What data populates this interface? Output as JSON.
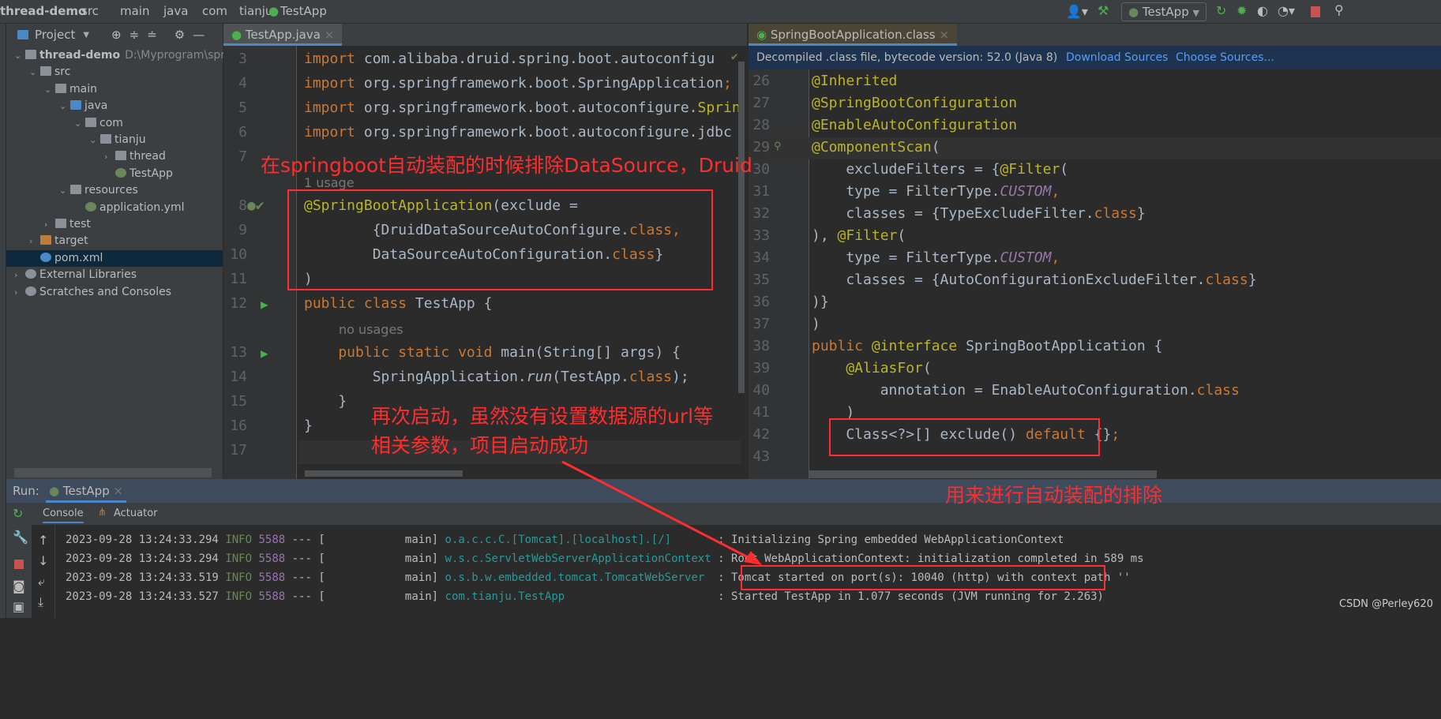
{
  "breadcrumb": [
    "thread-demo",
    "src",
    "main",
    "java",
    "com",
    "tianju",
    "TestApp"
  ],
  "toolbar": {
    "run_config": "TestApp",
    "colors": {
      "green": "#4caf50",
      "stop": "#c75450"
    }
  },
  "project": {
    "title": "Project",
    "tree": [
      {
        "label": "thread-demo",
        "extra": "D:\\Myprogram\\spring",
        "indent": 0,
        "arrow": "v",
        "icon": "folder",
        "bold": true
      },
      {
        "label": "src",
        "indent": 1,
        "arrow": "v",
        "icon": "folder"
      },
      {
        "label": "main",
        "indent": 2,
        "arrow": "v",
        "icon": "folder"
      },
      {
        "label": "java",
        "indent": 3,
        "arrow": "v",
        "icon": "folder-blue"
      },
      {
        "label": "com",
        "indent": 4,
        "arrow": "v",
        "icon": "package"
      },
      {
        "label": "tianju",
        "indent": 5,
        "arrow": "v",
        "icon": "package"
      },
      {
        "label": "thread",
        "indent": 6,
        "arrow": ">",
        "icon": "package"
      },
      {
        "label": "TestApp",
        "indent": 6,
        "arrow": "",
        "icon": "spring-class"
      },
      {
        "label": "resources",
        "indent": 3,
        "arrow": "v",
        "icon": "folder"
      },
      {
        "label": "application.yml",
        "indent": 4,
        "arrow": "",
        "icon": "spring-yml"
      },
      {
        "label": "test",
        "indent": 2,
        "arrow": ">",
        "icon": "folder"
      },
      {
        "label": "target",
        "indent": 1,
        "arrow": ">",
        "icon": "folder-orange"
      },
      {
        "label": "pom.xml",
        "indent": 1,
        "arrow": "",
        "icon": "maven",
        "selected": true
      },
      {
        "label": "External Libraries",
        "indent": 0,
        "arrow": ">",
        "icon": "libraries"
      },
      {
        "label": "Scratches and Consoles",
        "indent": 0,
        "arrow": ">",
        "icon": "scratches"
      }
    ]
  },
  "editor_left": {
    "tab": "TestApp.java",
    "lines": [
      {
        "n": "3",
        "tokens": [
          [
            "kw",
            "import "
          ],
          [
            "",
            "com.alibaba.druid.spring.boot.autoconfigu"
          ]
        ]
      },
      {
        "n": "4",
        "tokens": [
          [
            "kw",
            "import "
          ],
          [
            "",
            "org.springframework.boot.SpringApplication"
          ],
          [
            "kw",
            ";"
          ]
        ]
      },
      {
        "n": "5",
        "tokens": [
          [
            "kw",
            "import "
          ],
          [
            "",
            "org.springframework.boot.autoconfigure."
          ],
          [
            "an",
            "Sprin"
          ]
        ]
      },
      {
        "n": "6",
        "tokens": [
          [
            "kw",
            "import "
          ],
          [
            "",
            "org.springframework.boot.autoconfigure.jdbc"
          ]
        ]
      },
      {
        "n": "7",
        "tokens": []
      },
      {
        "hint": "1 usage"
      },
      {
        "n": "8",
        "tokens": [
          [
            "an",
            "@SpringBootApplication"
          ],
          [
            "",
            "(exclude ="
          ]
        ]
      },
      {
        "n": "9",
        "tokens": [
          [
            "",
            "        {DruidDataSourceAutoConfigure."
          ],
          [
            "kw",
            "class"
          ],
          [
            "kw",
            ","
          ]
        ]
      },
      {
        "n": "10",
        "tokens": [
          [
            "",
            "        DataSourceAutoConfiguration."
          ],
          [
            "kw",
            "class"
          ],
          [
            "",
            "}"
          ]
        ]
      },
      {
        "n": "11",
        "tokens": [
          [
            "",
            ")"
          ]
        ]
      },
      {
        "n": "12",
        "tokens": [
          [
            "kw",
            "public class "
          ],
          [
            "",
            "TestApp {"
          ]
        ]
      },
      {
        "hint": "no usages"
      },
      {
        "n": "13",
        "tokens": [
          [
            "kw",
            "    public static void "
          ],
          [
            "",
            "main(String[] args) {"
          ]
        ]
      },
      {
        "n": "14",
        "tokens": [
          [
            "",
            "        SpringApplication."
          ],
          [
            "it",
            "run"
          ],
          [
            "",
            "(TestApp."
          ],
          [
            "kw",
            "class"
          ],
          [
            "",
            "); "
          ]
        ]
      },
      {
        "n": "15",
        "tokens": [
          [
            "",
            "    }"
          ]
        ]
      },
      {
        "n": "16",
        "tokens": [
          [
            "",
            "}"
          ]
        ]
      },
      {
        "n": "17",
        "tokens": []
      }
    ]
  },
  "editor_right": {
    "tab": "SpringBootApplication.class",
    "banner": "Decompiled .class file, bytecode version: 52.0 (Java 8)",
    "download_sources": "Download Sources",
    "choose_sources": "Choose Sources...",
    "lines": [
      {
        "n": "26",
        "tokens": [
          [
            "an",
            "@Inherited"
          ]
        ]
      },
      {
        "n": "27",
        "tokens": [
          [
            "an",
            "@SpringBootConfiguration"
          ]
        ]
      },
      {
        "n": "28",
        "tokens": [
          [
            "an",
            "@EnableAutoConfiguration"
          ]
        ]
      },
      {
        "n": "29",
        "tokens": [
          [
            "an",
            "@ComponentScan"
          ],
          [
            "",
            "("
          ]
        ]
      },
      {
        "n": "30",
        "tokens": [
          [
            "",
            "    excludeFilters = {"
          ],
          [
            "an",
            "@Filter"
          ],
          [
            "",
            "("
          ]
        ]
      },
      {
        "n": "31",
        "tokens": [
          [
            "",
            "    type = FilterType."
          ],
          [
            "pu",
            "CUSTOM"
          ],
          [
            "kw",
            ","
          ]
        ]
      },
      {
        "n": "32",
        "tokens": [
          [
            "",
            "    classes = {TypeExcludeFilter."
          ],
          [
            "kw",
            "class"
          ],
          [
            "",
            "}"
          ]
        ]
      },
      {
        "n": "33",
        "tokens": [
          [
            "",
            "), "
          ],
          [
            "an",
            "@Filter"
          ],
          [
            "",
            "("
          ]
        ]
      },
      {
        "n": "34",
        "tokens": [
          [
            "",
            "    type = FilterType."
          ],
          [
            "pu",
            "CUSTOM"
          ],
          [
            "kw",
            ","
          ]
        ]
      },
      {
        "n": "35",
        "tokens": [
          [
            "",
            "    classes = {AutoConfigurationExcludeFilter."
          ],
          [
            "kw",
            "class"
          ],
          [
            "",
            "}"
          ]
        ]
      },
      {
        "n": "36",
        "tokens": [
          [
            "",
            ")}"
          ]
        ]
      },
      {
        "n": "37",
        "tokens": [
          [
            "",
            ")"
          ]
        ]
      },
      {
        "n": "38",
        "tokens": [
          [
            "kw",
            "public "
          ],
          [
            "an",
            "@interface "
          ],
          [
            "",
            "SpringBootApplication {"
          ]
        ]
      },
      {
        "n": "39",
        "tokens": [
          [
            "an",
            "    @AliasFor"
          ],
          [
            "",
            "("
          ]
        ]
      },
      {
        "n": "40",
        "tokens": [
          [
            "",
            "        annotation = EnableAutoConfiguration."
          ],
          [
            "kw",
            "class"
          ]
        ]
      },
      {
        "n": "41",
        "tokens": [
          [
            "",
            "    )"
          ]
        ]
      },
      {
        "n": "42",
        "tokens": [
          [
            "",
            "    Class<?>[] exclude() "
          ],
          [
            "kw",
            "default "
          ],
          [
            "",
            "{}"
          ],
          [
            "kw",
            ";"
          ]
        ]
      },
      {
        "n": "43",
        "tokens": []
      }
    ]
  },
  "run": {
    "label": "Run:",
    "tab": "TestApp",
    "console_tab": "Console",
    "actuator_tab": "Actuator",
    "logs": [
      {
        "date": "2023-09-28 13:24:33.294",
        "level": "INFO",
        "pid": "5588",
        "sep": "--- [",
        "thread": "           main]",
        "logger": "o.a.c.c.C.[Tomcat].[localhost].[/]      ",
        "msg": ": Initializing Spring embedded WebApplicationContext"
      },
      {
        "date": "2023-09-28 13:24:33.294",
        "level": "INFO",
        "pid": "5588",
        "sep": "--- [",
        "thread": "           main]",
        "logger": "w.s.c.ServletWebServerApplicationContext",
        "msg": ": Root WebApplicationContext: initialization completed in 589 ms"
      },
      {
        "date": "2023-09-28 13:24:33.519",
        "level": "INFO",
        "pid": "5588",
        "sep": "--- [",
        "thread": "           main]",
        "logger": "o.s.b.w.embedded.tomcat.TomcatWebServer ",
        "msg": ": Tomcat started on port(s): 10040 (http) with context path ''"
      },
      {
        "date": "2023-09-28 13:24:33.527",
        "level": "INFO",
        "pid": "5588",
        "sep": "--- [",
        "thread": "           main]",
        "logger": "com.tianju.TestApp                      ",
        "msg": ": Started TestApp in 1.077 seconds (JVM running for 2.263)"
      }
    ]
  },
  "annotations": {
    "top": "在springboot自动装配的时候排除DataSource，Druid",
    "middle_line1": "再次启动，虽然没有设置数据源的url等",
    "middle_line2": "相关参数，项目启动成功",
    "right": "用来进行自动装配的排除",
    "color": "#ff2d2d"
  },
  "watermark": "CSDN @Perley620"
}
